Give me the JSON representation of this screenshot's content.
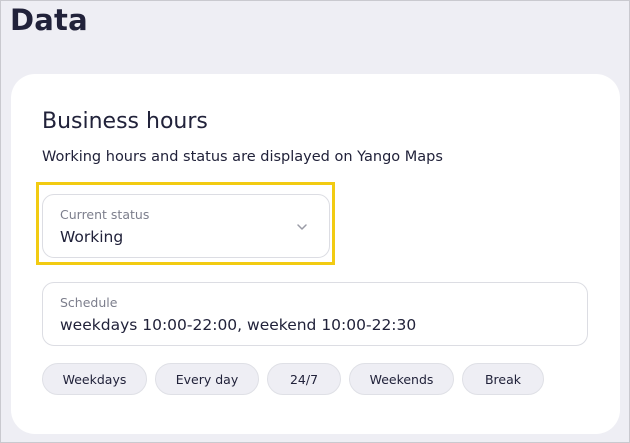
{
  "page": {
    "title": "Data"
  },
  "business_hours": {
    "title": "Business hours",
    "subtitle": "Working hours and status are displayed on Yango Maps",
    "current_status": {
      "label": "Current status",
      "value": "Working"
    },
    "schedule": {
      "label": "Schedule",
      "value": "weekdays 10:00-22:00, weekend 10:00-22:30"
    },
    "presets": [
      "Weekdays",
      "Every day",
      "24/7",
      "Weekends",
      "Break"
    ]
  },
  "colors": {
    "background": "#eeeef4",
    "card": "#ffffff",
    "highlight": "#f2cb12",
    "text": "#21223a",
    "muted_text": "#7c7e8c",
    "chip_bg": "#eeeef4"
  },
  "icons": {
    "status_dropdown": "chevron-down-icon"
  }
}
